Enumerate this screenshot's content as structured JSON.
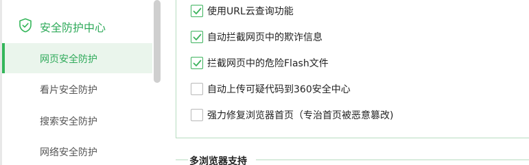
{
  "sidebar": {
    "header": {
      "label": "安全防护中心",
      "icon": "shield-check-icon"
    },
    "items": [
      {
        "label": "网页安全防护",
        "active": true
      },
      {
        "label": "看片安全防护",
        "active": false
      },
      {
        "label": "搜索安全防护",
        "active": false
      },
      {
        "label": "网络安全防护",
        "active": false
      }
    ]
  },
  "options": [
    {
      "label": "使用URL云查询功能",
      "checked": true
    },
    {
      "label": "自动拦截网页中的欺诈信息",
      "checked": true
    },
    {
      "label": "拦截网页中的危险Flash文件",
      "checked": true
    },
    {
      "label": "自动上传可疑代码到360安全中心",
      "checked": false
    },
    {
      "label": "强力修复浏览器首页（专治首页被恶意篡改)",
      "checked": false
    }
  ],
  "section2": {
    "title": "多浏览器支持"
  },
  "colors": {
    "accent": "#34b65a",
    "active_bg": "#eaf5ec",
    "panel_border": "#b7dcc0"
  }
}
